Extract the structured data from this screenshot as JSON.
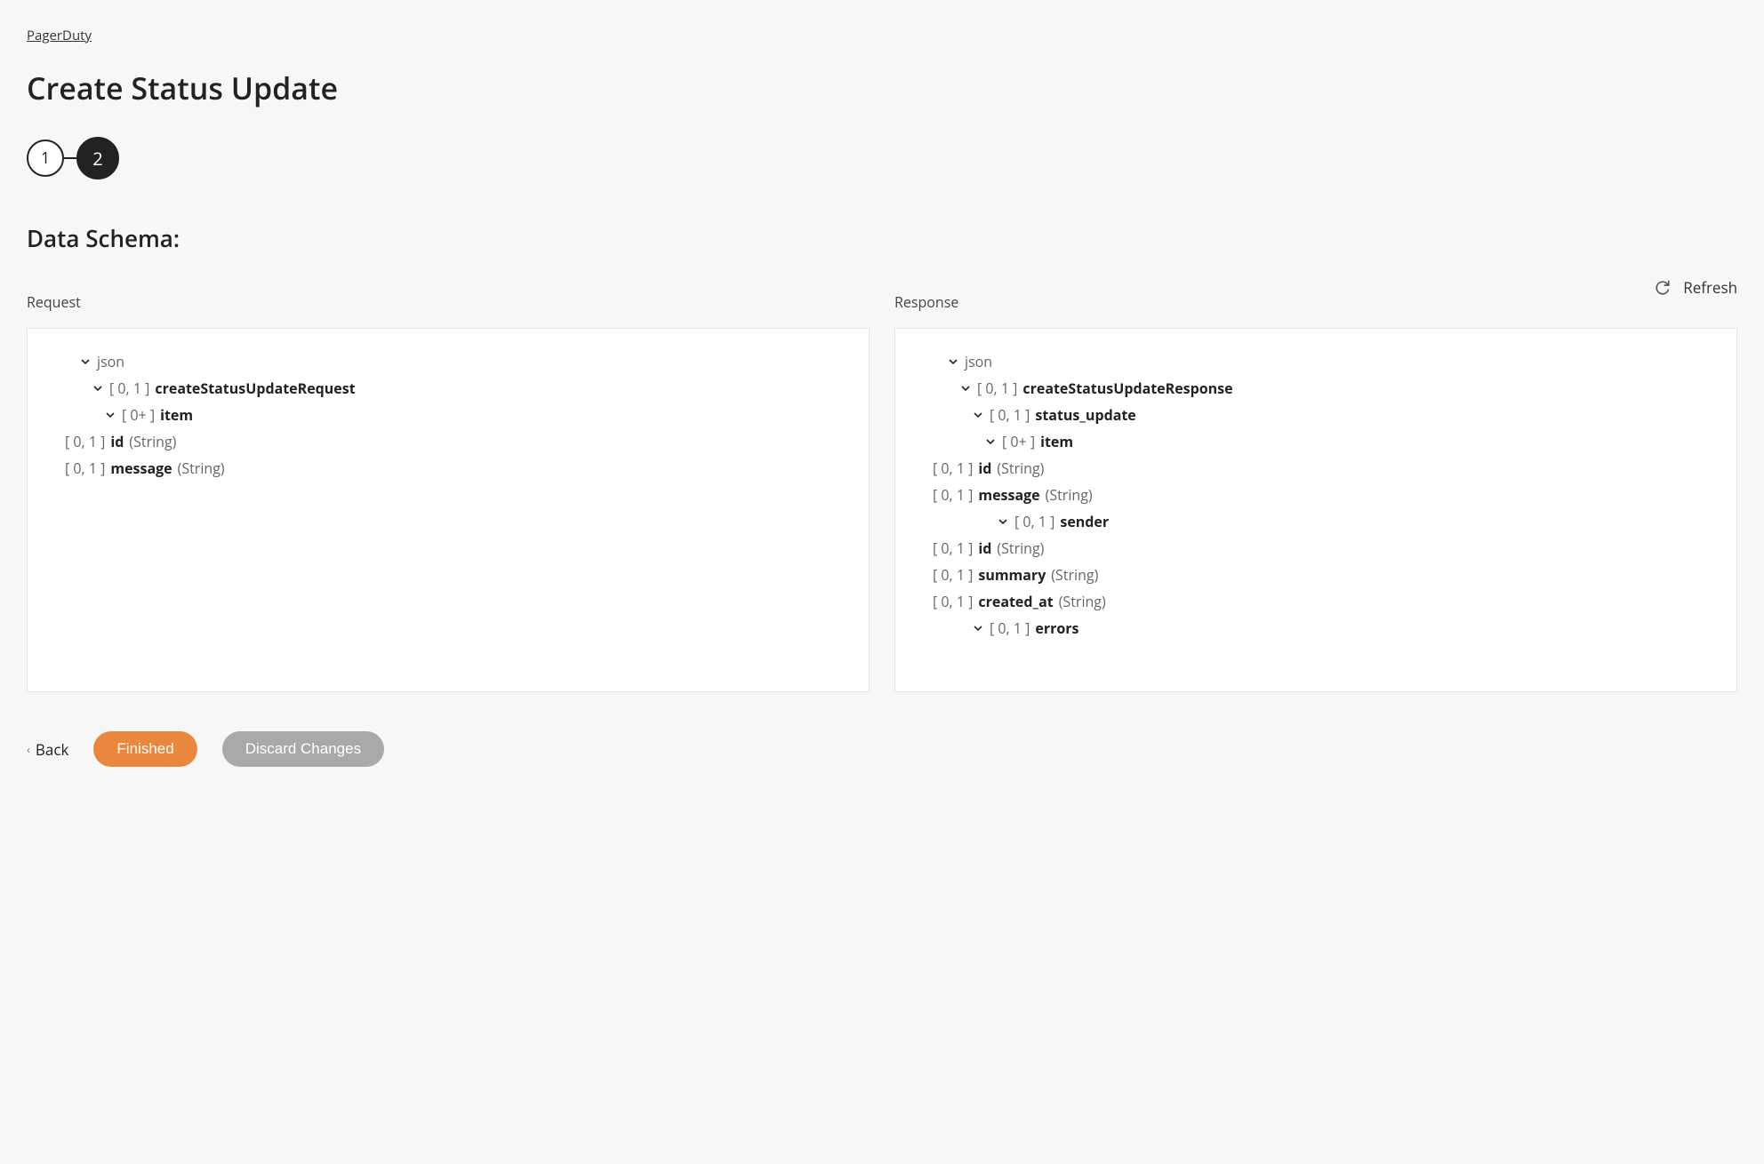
{
  "breadcrumb": "PagerDuty",
  "title": "Create Status Update",
  "stepper": {
    "step1": "1",
    "step2": "2"
  },
  "section_title": "Data Schema:",
  "refresh_label": "Refresh",
  "request": {
    "label": "Request",
    "tree": {
      "root": "json",
      "l1": {
        "card": "[ 0, 1 ]",
        "name": "createStatusUpdateRequest"
      },
      "l2": {
        "card": "[ 0+ ]",
        "name": "item"
      },
      "l3a": {
        "card": "[ 0, 1 ]",
        "name": "id",
        "type": "(String)"
      },
      "l3b": {
        "card": "[ 0, 1 ]",
        "name": "message",
        "type": "(String)"
      }
    }
  },
  "response": {
    "label": "Response",
    "tree": {
      "root": "json",
      "l1": {
        "card": "[ 0, 1 ]",
        "name": "createStatusUpdateResponse"
      },
      "l2": {
        "card": "[ 0, 1 ]",
        "name": "status_update"
      },
      "l3": {
        "card": "[ 0+ ]",
        "name": "item"
      },
      "l4a": {
        "card": "[ 0, 1 ]",
        "name": "id",
        "type": "(String)"
      },
      "l4b": {
        "card": "[ 0, 1 ]",
        "name": "message",
        "type": "(String)"
      },
      "l4c": {
        "card": "[ 0, 1 ]",
        "name": "sender"
      },
      "l5a": {
        "card": "[ 0, 1 ]",
        "name": "id",
        "type": "(String)"
      },
      "l5b": {
        "card": "[ 0, 1 ]",
        "name": "summary",
        "type": "(String)"
      },
      "l4d": {
        "card": "[ 0, 1 ]",
        "name": "created_at",
        "type": "(String)"
      },
      "l2b": {
        "card": "[ 0, 1 ]",
        "name": "errors"
      }
    }
  },
  "footer": {
    "back": "Back",
    "finished": "Finished",
    "discard": "Discard Changes"
  }
}
